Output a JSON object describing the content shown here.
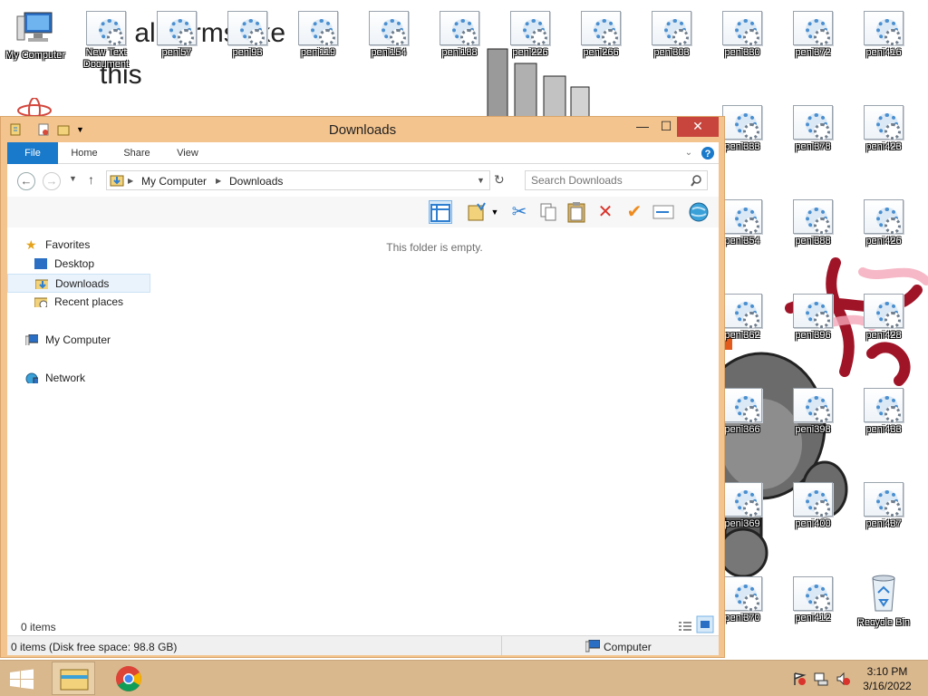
{
  "desktop": {
    "wall_text": {
      "line1": "all all forms like",
      "line2": "this"
    },
    "icons": [
      {
        "label": "My Computer",
        "kind": "computer"
      },
      {
        "label": "New Text Document",
        "kind": "file"
      },
      {
        "label": "peni57",
        "kind": "file"
      },
      {
        "label": "peni93",
        "kind": "file"
      },
      {
        "label": "peni119",
        "kind": "file"
      },
      {
        "label": "peni154",
        "kind": "file"
      },
      {
        "label": "peni188",
        "kind": "file"
      },
      {
        "label": "peni226",
        "kind": "file"
      },
      {
        "label": "peni266",
        "kind": "file"
      },
      {
        "label": "peni303",
        "kind": "file"
      },
      {
        "label": "peni330",
        "kind": "file"
      },
      {
        "label": "peni372",
        "kind": "file"
      },
      {
        "label": "peni416",
        "kind": "file"
      },
      {
        "label": "peni333",
        "kind": "file"
      },
      {
        "label": "peni378",
        "kind": "file"
      },
      {
        "label": "peni423",
        "kind": "file"
      },
      {
        "label": "peni354",
        "kind": "file"
      },
      {
        "label": "peni388",
        "kind": "file"
      },
      {
        "label": "peni426",
        "kind": "file"
      },
      {
        "label": "peni362",
        "kind": "file"
      },
      {
        "label": "peni396",
        "kind": "file"
      },
      {
        "label": "peni428",
        "kind": "file"
      },
      {
        "label": "peni366",
        "kind": "file"
      },
      {
        "label": "peni398",
        "kind": "file"
      },
      {
        "label": "peni433",
        "kind": "file"
      },
      {
        "label": "peni369",
        "kind": "file"
      },
      {
        "label": "peni400",
        "kind": "file"
      },
      {
        "label": "peni437",
        "kind": "file"
      },
      {
        "label": "peni370",
        "kind": "file"
      },
      {
        "label": "peni412",
        "kind": "file"
      },
      {
        "label": "Recycle Bin",
        "kind": "recycle-bin"
      }
    ]
  },
  "window": {
    "title": "Downloads",
    "controls": {
      "minimize": "—",
      "maximize": "☐",
      "close": "✕"
    },
    "ribbon_tabs": [
      "File",
      "Home",
      "Share",
      "View"
    ],
    "address_path": [
      "My Computer",
      "Downloads"
    ],
    "search_placeholder": "Search Downloads",
    "toolbar_icons": [
      "layout-pane-icon",
      "new-folder-icon",
      "cut-icon",
      "copy-icon",
      "paste-icon",
      "delete-icon",
      "checkmark-icon",
      "rename-icon",
      "globe-icon"
    ],
    "nav": {
      "favorites_label": "Favorites",
      "favorites": [
        "Desktop",
        "Downloads",
        "Recent places"
      ],
      "computer_label": "My Computer",
      "network_label": "Network",
      "selected": "Downloads"
    },
    "empty_message": "This folder is empty.",
    "item_count": "0 items",
    "status_text": "0 items (Disk free space: 98.8 GB)",
    "status_location": "Computer"
  },
  "taskbar": {
    "apps": [
      "file-explorer-icon",
      "chrome-icon"
    ],
    "time": "3:10 PM",
    "date": "3/16/2022"
  },
  "colors": {
    "window_frame": "#f4c48e",
    "close_button": "#c7453c",
    "file_tab": "#1979ca",
    "taskbar": "#d9b88e"
  }
}
